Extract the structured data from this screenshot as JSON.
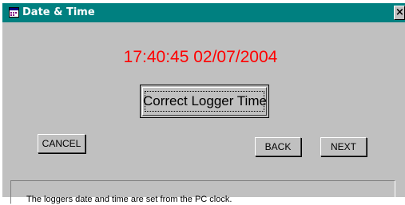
{
  "window": {
    "title": "Date & Time",
    "close_glyph": "×",
    "title_icon": "calendar-icon",
    "colors": {
      "titlebar": "#008080",
      "face": "#c0c0c0",
      "clock_text": "#ff0000"
    }
  },
  "clock": {
    "datetime": "17:40:45 02/07/2004"
  },
  "buttons": {
    "correct_label": "Correct Logger Time",
    "cancel_label": "CANCEL",
    "back_label": "BACK",
    "next_label": "NEXT"
  },
  "status": {
    "message": "The loggers date and time are set from the PC clock."
  }
}
